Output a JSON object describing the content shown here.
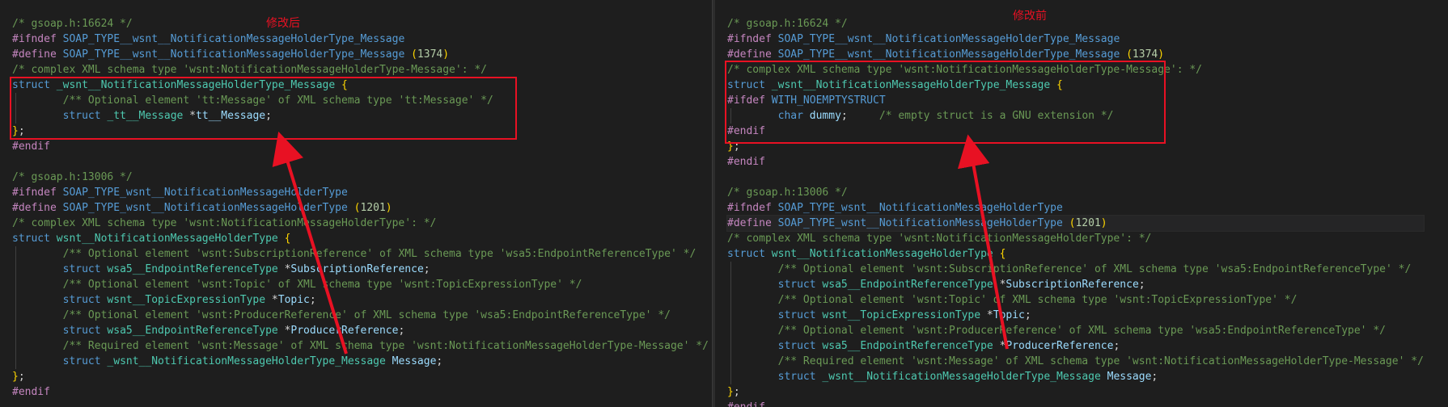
{
  "left": {
    "label": "修改后",
    "lines": [
      [
        [
          "c-comment",
          "/* gsoap.h:16624 */"
        ]
      ],
      [
        [
          "c-pre",
          "#ifndef "
        ],
        [
          "c-macro",
          "SOAP_TYPE__wsnt__NotificationMessageHolderType_Message"
        ]
      ],
      [
        [
          "c-pre",
          "#define "
        ],
        [
          "c-macro",
          "SOAP_TYPE__wsnt__NotificationMessageHolderType_Message "
        ],
        [
          "c-brace",
          "("
        ],
        [
          "c-num",
          "1374"
        ],
        [
          "c-brace",
          ")"
        ]
      ],
      [
        [
          "c-comment",
          "/* complex XML schema type 'wsnt:NotificationMessageHolderType-Message': */"
        ]
      ],
      [
        [
          "c-kw",
          "struct "
        ],
        [
          "c-type",
          "_wsnt__NotificationMessageHolderType_Message "
        ],
        [
          "c-brace",
          "{"
        ]
      ],
      [
        [
          "c-plain",
          "        "
        ],
        [
          "c-comment",
          "/** Optional element 'tt:Message' of XML schema type 'tt:Message' */"
        ]
      ],
      [
        [
          "c-plain",
          "        "
        ],
        [
          "c-kw",
          "struct "
        ],
        [
          "c-type",
          "_tt__Message "
        ],
        [
          "c-plain",
          "*"
        ],
        [
          "c-id",
          "tt__Message"
        ],
        [
          "c-plain",
          ";"
        ]
      ],
      [
        [
          "c-brace",
          "}"
        ],
        [
          "c-plain",
          ";"
        ]
      ],
      [
        [
          "c-pre",
          "#endif"
        ]
      ],
      [
        [
          "c-plain",
          ""
        ]
      ],
      [
        [
          "c-comment",
          "/* gsoap.h:13006 */"
        ]
      ],
      [
        [
          "c-pre",
          "#ifndef "
        ],
        [
          "c-macro",
          "SOAP_TYPE_wsnt__NotificationMessageHolderType"
        ]
      ],
      [
        [
          "c-pre",
          "#define "
        ],
        [
          "c-macro",
          "SOAP_TYPE_wsnt__NotificationMessageHolderType "
        ],
        [
          "c-brace",
          "("
        ],
        [
          "c-num",
          "1201"
        ],
        [
          "c-brace",
          ")"
        ]
      ],
      [
        [
          "c-comment",
          "/* complex XML schema type 'wsnt:NotificationMessageHolderType': */"
        ]
      ],
      [
        [
          "c-kw",
          "struct "
        ],
        [
          "c-type",
          "wsnt__NotificationMessageHolderType "
        ],
        [
          "c-brace",
          "{"
        ]
      ],
      [
        [
          "c-plain",
          "        "
        ],
        [
          "c-comment",
          "/** Optional element 'wsnt:SubscriptionReference' of XML schema type 'wsa5:EndpointReferenceType' */"
        ]
      ],
      [
        [
          "c-plain",
          "        "
        ],
        [
          "c-kw",
          "struct "
        ],
        [
          "c-type",
          "wsa5__EndpointReferenceType "
        ],
        [
          "c-plain",
          "*"
        ],
        [
          "c-id",
          "SubscriptionReference"
        ],
        [
          "c-plain",
          ";"
        ]
      ],
      [
        [
          "c-plain",
          "        "
        ],
        [
          "c-comment",
          "/** Optional element 'wsnt:Topic' of XML schema type 'wsnt:TopicExpressionType' */"
        ]
      ],
      [
        [
          "c-plain",
          "        "
        ],
        [
          "c-kw",
          "struct "
        ],
        [
          "c-type",
          "wsnt__TopicExpressionType "
        ],
        [
          "c-plain",
          "*"
        ],
        [
          "c-id",
          "Topic"
        ],
        [
          "c-plain",
          ";"
        ]
      ],
      [
        [
          "c-plain",
          "        "
        ],
        [
          "c-comment",
          "/** Optional element 'wsnt:ProducerReference' of XML schema type 'wsa5:EndpointReferenceType' */"
        ]
      ],
      [
        [
          "c-plain",
          "        "
        ],
        [
          "c-kw",
          "struct "
        ],
        [
          "c-type",
          "wsa5__EndpointReferenceType "
        ],
        [
          "c-plain",
          "*"
        ],
        [
          "c-id",
          "ProducerReference"
        ],
        [
          "c-plain",
          ";"
        ]
      ],
      [
        [
          "c-plain",
          "        "
        ],
        [
          "c-comment",
          "/** Required element 'wsnt:Message' of XML schema type 'wsnt:NotificationMessageHolderType-Message' */"
        ]
      ],
      [
        [
          "c-plain",
          "        "
        ],
        [
          "c-kw",
          "struct "
        ],
        [
          "c-type",
          "_wsnt__NotificationMessageHolderType_Message "
        ],
        [
          "c-id",
          "Message"
        ],
        [
          "c-plain",
          ";"
        ]
      ],
      [
        [
          "c-brace",
          "}"
        ],
        [
          "c-plain",
          ";"
        ]
      ],
      [
        [
          "c-pre",
          "#endif"
        ]
      ]
    ]
  },
  "right": {
    "label": "修改前",
    "lines": [
      [
        [
          "c-comment",
          "/* gsoap.h:16624 */"
        ]
      ],
      [
        [
          "c-pre",
          "#ifndef "
        ],
        [
          "c-macro",
          "SOAP_TYPE__wsnt__NotificationMessageHolderType_Message"
        ]
      ],
      [
        [
          "c-pre",
          "#define "
        ],
        [
          "c-macro",
          "SOAP_TYPE__wsnt__NotificationMessageHolderType_Message "
        ],
        [
          "c-brace",
          "("
        ],
        [
          "c-num",
          "1374"
        ],
        [
          "c-brace",
          ")"
        ]
      ],
      [
        [
          "c-comment",
          "/* complex XML schema type 'wsnt:NotificationMessageHolderType-Message': */"
        ]
      ],
      [
        [
          "c-kw",
          "struct "
        ],
        [
          "c-type",
          "_wsnt__NotificationMessageHolderType_Message "
        ],
        [
          "c-brace",
          "{"
        ]
      ],
      [
        [
          "c-pre",
          "#ifdef "
        ],
        [
          "c-macro",
          "WITH_NOEMPTYSTRUCT"
        ]
      ],
      [
        [
          "c-plain",
          "        "
        ],
        [
          "c-kw",
          "char "
        ],
        [
          "c-id",
          "dummy"
        ],
        [
          "c-plain",
          ";     "
        ],
        [
          "c-comment",
          "/* empty struct is a GNU extension */"
        ]
      ],
      [
        [
          "c-pre",
          "#endif"
        ]
      ],
      [
        [
          "c-brace",
          "}"
        ],
        [
          "c-plain",
          ";"
        ]
      ],
      [
        [
          "c-pre",
          "#endif"
        ]
      ],
      [
        [
          "c-plain",
          ""
        ]
      ],
      [
        [
          "c-comment",
          "/* gsoap.h:13006 */"
        ]
      ],
      [
        [
          "c-pre",
          "#ifndef "
        ],
        [
          "c-macro",
          "SOAP_TYPE_wsnt__NotificationMessageHolderType"
        ]
      ],
      [
        [
          "c-pre",
          "#define "
        ],
        [
          "c-macro",
          "SOAP_TYPE_wsnt__NotificationMessageHolderType "
        ],
        [
          "c-brace",
          "("
        ],
        [
          "c-num",
          "1201"
        ],
        [
          "c-brace",
          ")"
        ]
      ],
      [
        [
          "c-comment",
          "/* complex XML schema type 'wsnt:NotificationMessageHolderType': */"
        ]
      ],
      [
        [
          "c-kw",
          "struct "
        ],
        [
          "c-type",
          "wsnt__NotificationMessageHolderType "
        ],
        [
          "c-brace",
          "{"
        ]
      ],
      [
        [
          "c-plain",
          "        "
        ],
        [
          "c-comment",
          "/** Optional element 'wsnt:SubscriptionReference' of XML schema type 'wsa5:EndpointReferenceType' */"
        ]
      ],
      [
        [
          "c-plain",
          "        "
        ],
        [
          "c-kw",
          "struct "
        ],
        [
          "c-type",
          "wsa5__EndpointReferenceType "
        ],
        [
          "c-plain",
          "*"
        ],
        [
          "c-id",
          "SubscriptionReference"
        ],
        [
          "c-plain",
          ";"
        ]
      ],
      [
        [
          "c-plain",
          "        "
        ],
        [
          "c-comment",
          "/** Optional element 'wsnt:Topic' of XML schema type 'wsnt:TopicExpressionType' */"
        ]
      ],
      [
        [
          "c-plain",
          "        "
        ],
        [
          "c-kw",
          "struct "
        ],
        [
          "c-type",
          "wsnt__TopicExpressionType "
        ],
        [
          "c-plain",
          "*"
        ],
        [
          "c-id",
          "Topic"
        ],
        [
          "c-plain",
          ";"
        ]
      ],
      [
        [
          "c-plain",
          "        "
        ],
        [
          "c-comment",
          "/** Optional element 'wsnt:ProducerReference' of XML schema type 'wsa5:EndpointReferenceType' */"
        ]
      ],
      [
        [
          "c-plain",
          "        "
        ],
        [
          "c-kw",
          "struct "
        ],
        [
          "c-type",
          "wsa5__EndpointReferenceType "
        ],
        [
          "c-plain",
          "*"
        ],
        [
          "c-id",
          "ProducerReference"
        ],
        [
          "c-plain",
          ";"
        ]
      ],
      [
        [
          "c-plain",
          "        "
        ],
        [
          "c-comment",
          "/** Required element 'wsnt:Message' of XML schema type 'wsnt:NotificationMessageHolderType-Message' */"
        ]
      ],
      [
        [
          "c-plain",
          "        "
        ],
        [
          "c-kw",
          "struct "
        ],
        [
          "c-type",
          "_wsnt__NotificationMessageHolderType_Message "
        ],
        [
          "c-id",
          "Message"
        ],
        [
          "c-plain",
          ";"
        ]
      ],
      [
        [
          "c-brace",
          "}"
        ],
        [
          "c-plain",
          ";"
        ]
      ],
      [
        [
          "c-pre",
          "#endif"
        ]
      ]
    ]
  },
  "colors": {
    "annotation": "#e81123",
    "background": "#1e1e1e"
  }
}
